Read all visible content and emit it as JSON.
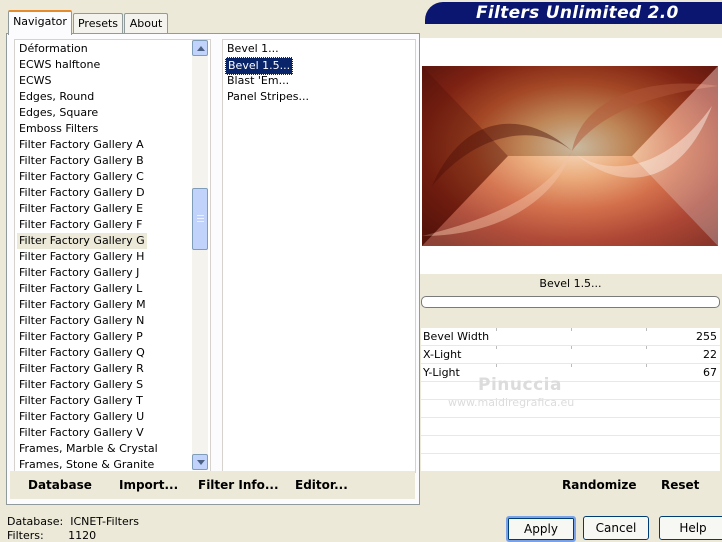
{
  "window": {
    "title": "Filters Unlimited 2.0"
  },
  "tabs": [
    {
      "label": "Navigator",
      "active": true
    },
    {
      "label": "Presets",
      "active": false
    },
    {
      "label": "About",
      "active": false
    }
  ],
  "categories": {
    "items": [
      "Déformation",
      "ECWS halftone",
      "ECWS",
      "Edges, Round",
      "Edges, Square",
      "Emboss Filters",
      "Filter Factory Gallery A",
      "Filter Factory Gallery B",
      "Filter Factory Gallery C",
      "Filter Factory Gallery D",
      "Filter Factory Gallery E",
      "Filter Factory Gallery F",
      "Filter Factory Gallery G",
      "Filter Factory Gallery H",
      "Filter Factory Gallery J",
      "Filter Factory Gallery L",
      "Filter Factory Gallery M",
      "Filter Factory Gallery N",
      "Filter Factory Gallery P",
      "Filter Factory Gallery Q",
      "Filter Factory Gallery R",
      "Filter Factory Gallery S",
      "Filter Factory Gallery T",
      "Filter Factory Gallery U",
      "Filter Factory Gallery V",
      "Frames, Marble & Crystal",
      "Frames, Stone & Granite"
    ],
    "selected": "Filter Factory Gallery G"
  },
  "filters": {
    "items": [
      "Bevel 1...",
      "Bevel 1.5...",
      "Blast 'Em...",
      "Panel Stripes..."
    ],
    "selected": "Bevel 1.5..."
  },
  "nav_buttons": {
    "database": "Database",
    "import": "Import...",
    "filter_info": "Filter Info...",
    "editor": "Editor..."
  },
  "preview": {
    "filter_name": "Bevel 1.5..."
  },
  "params": [
    {
      "label": "Bevel Width",
      "value": "255"
    },
    {
      "label": "X-Light",
      "value": "22"
    },
    {
      "label": "Y-Light",
      "value": "67"
    }
  ],
  "watermark": {
    "line1": "Pinuccia",
    "line2": "www.maidiregrafica.eu"
  },
  "right_buttons": {
    "randomize": "Randomize",
    "reset": "Reset"
  },
  "status": {
    "database_label": "Database:",
    "database_value": "ICNET-Filters",
    "filters_label": "Filters:",
    "filters_value": "1120"
  },
  "dialog_buttons": {
    "apply": "Apply",
    "cancel": "Cancel",
    "help": "Help"
  }
}
